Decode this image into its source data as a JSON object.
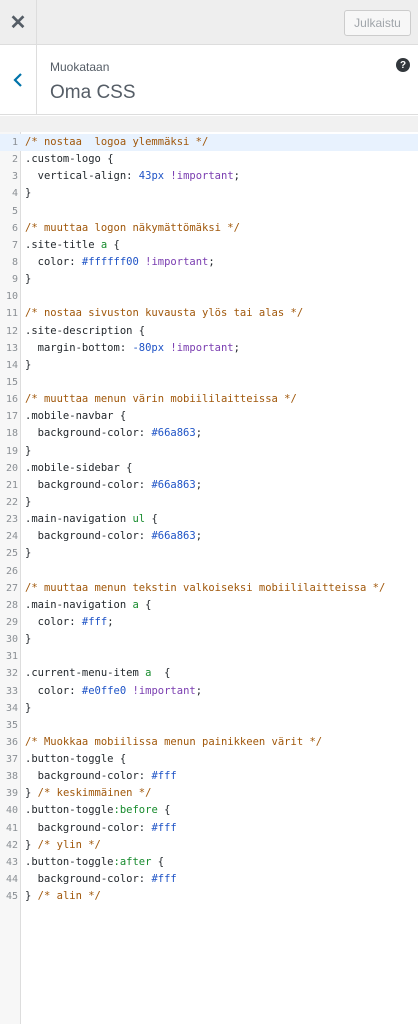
{
  "topbar": {
    "close_icon": "close-icon",
    "publish_label": "Julkaistu"
  },
  "header": {
    "subtitle": "Muokataan",
    "title": "Oma CSS",
    "back_icon": "chevron-left-icon",
    "help_icon": "help-icon",
    "help_glyph": "?"
  },
  "editor": {
    "active_line": 1,
    "lines": [
      [
        [
          "c",
          "/* nostaa  logoa ylemmäksi */"
        ]
      ],
      [
        [
          "s",
          ".custom-logo "
        ],
        [
          "p",
          "{"
        ]
      ],
      [
        [
          "r",
          "  vertical-align: "
        ],
        [
          "v",
          "43px"
        ],
        [
          "r",
          " "
        ],
        [
          "i",
          "!important"
        ],
        [
          "p",
          ";"
        ]
      ],
      [
        [
          "p",
          "}"
        ]
      ],
      [],
      [
        [
          "c",
          "/* muuttaa logon näkymättömäksi */"
        ]
      ],
      [
        [
          "s",
          ".site-title "
        ],
        [
          "t",
          "a"
        ],
        [
          "p",
          " {"
        ]
      ],
      [
        [
          "r",
          "  color: "
        ],
        [
          "v",
          "#ffffff00"
        ],
        [
          "r",
          " "
        ],
        [
          "i",
          "!important"
        ],
        [
          "p",
          ";"
        ]
      ],
      [
        [
          "p",
          "}"
        ]
      ],
      [],
      [
        [
          "c",
          "/* nostaa sivuston kuvausta ylös tai alas */"
        ]
      ],
      [
        [
          "s",
          ".site-description "
        ],
        [
          "p",
          "{"
        ]
      ],
      [
        [
          "r",
          "  margin-bottom: "
        ],
        [
          "v",
          "-80px"
        ],
        [
          "r",
          " "
        ],
        [
          "i",
          "!important"
        ],
        [
          "p",
          ";"
        ]
      ],
      [
        [
          "p",
          "}"
        ]
      ],
      [],
      [
        [
          "c",
          "/* muuttaa menun värin mobiililaitteissa */"
        ]
      ],
      [
        [
          "s",
          ".mobile-navbar "
        ],
        [
          "p",
          "{"
        ]
      ],
      [
        [
          "r",
          "  background-color: "
        ],
        [
          "v",
          "#66a863"
        ],
        [
          "p",
          ";"
        ]
      ],
      [
        [
          "p",
          "}"
        ]
      ],
      [
        [
          "s",
          ".mobile-sidebar "
        ],
        [
          "p",
          "{"
        ]
      ],
      [
        [
          "r",
          "  background-color: "
        ],
        [
          "v",
          "#66a863"
        ],
        [
          "p",
          ";"
        ]
      ],
      [
        [
          "p",
          "}"
        ]
      ],
      [
        [
          "s",
          ".main-navigation "
        ],
        [
          "t",
          "ul"
        ],
        [
          "p",
          " {"
        ]
      ],
      [
        [
          "r",
          "  background-color: "
        ],
        [
          "v",
          "#66a863"
        ],
        [
          "p",
          ";"
        ]
      ],
      [
        [
          "p",
          "}"
        ]
      ],
      [],
      [
        [
          "c",
          "/* muuttaa menun tekstin valkoiseksi mobiililaitteissa */"
        ]
      ],
      [
        [
          "s",
          ".main-navigation "
        ],
        [
          "t",
          "a"
        ],
        [
          "p",
          " {"
        ]
      ],
      [
        [
          "r",
          "  color: "
        ],
        [
          "v",
          "#fff"
        ],
        [
          "p",
          ";"
        ]
      ],
      [
        [
          "p",
          "}"
        ]
      ],
      [],
      [
        [
          "s",
          ".current-menu-item "
        ],
        [
          "t",
          "a"
        ],
        [
          "p",
          "  {"
        ]
      ],
      [
        [
          "r",
          "  color: "
        ],
        [
          "v",
          "#e0ffe0"
        ],
        [
          "r",
          " "
        ],
        [
          "i",
          "!important"
        ],
        [
          "p",
          ";"
        ]
      ],
      [
        [
          "p",
          "}"
        ]
      ],
      [],
      [
        [
          "c",
          "/* Muokkaa mobiilissa menun painikkeen värit */"
        ]
      ],
      [
        [
          "s",
          ".button-toggle "
        ],
        [
          "p",
          "{"
        ]
      ],
      [
        [
          "r",
          "  background-color: "
        ],
        [
          "v",
          "#fff"
        ]
      ],
      [
        [
          "p",
          "} "
        ],
        [
          "c",
          "/* keskimmäinen */"
        ]
      ],
      [
        [
          "s",
          ".button-toggle"
        ],
        [
          "t",
          ":before"
        ],
        [
          "p",
          " {"
        ]
      ],
      [
        [
          "r",
          "  background-color: "
        ],
        [
          "v",
          "#fff"
        ]
      ],
      [
        [
          "p",
          "} "
        ],
        [
          "c",
          "/* ylin */"
        ]
      ],
      [
        [
          "s",
          ".button-toggle"
        ],
        [
          "t",
          ":after"
        ],
        [
          "p",
          " {"
        ]
      ],
      [
        [
          "r",
          "  background-color: "
        ],
        [
          "v",
          "#fff"
        ]
      ],
      [
        [
          "p",
          "} "
        ],
        [
          "c",
          "/* alin */"
        ]
      ]
    ]
  }
}
